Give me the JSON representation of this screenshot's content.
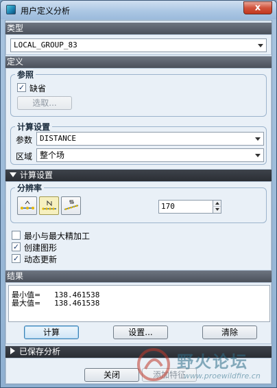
{
  "window": {
    "title": "用户定义分析",
    "close_glyph": "x"
  },
  "type_section": {
    "header": "类型",
    "value": "LOCAL_GROUP_83"
  },
  "definition_section": {
    "header": "定义",
    "reference": {
      "title": "参照",
      "default_label": "缺省",
      "default_checked": true,
      "select_button": "选取..."
    },
    "calc_settings": {
      "title": "计算设置",
      "param_label": "参数",
      "param_value": "DISTANCE",
      "region_label": "区域",
      "region_value": "整个场"
    }
  },
  "calc_settings_section": {
    "header": "计算设置",
    "resolution": {
      "title": "分辨率",
      "selected_index": 1,
      "value": "170"
    },
    "options": [
      {
        "label": "最小与最大精加工",
        "checked": false
      },
      {
        "label": "创建图形",
        "checked": true
      },
      {
        "label": "动态更新",
        "checked": true
      }
    ]
  },
  "results_section": {
    "header": "结果",
    "rows": [
      {
        "key": "最小值=",
        "value": "138.461538"
      },
      {
        "key": "最大值=",
        "value": "138.461538"
      }
    ]
  },
  "actions": {
    "compute": "计算",
    "settings": "设置...",
    "clear": "清除"
  },
  "saved_section": {
    "header": "已保存分析"
  },
  "footer": {
    "close": "关闭",
    "add_feature": "添加特征"
  },
  "watermark": {
    "name": "野火论坛",
    "url": "www.proewildfire.cn"
  }
}
